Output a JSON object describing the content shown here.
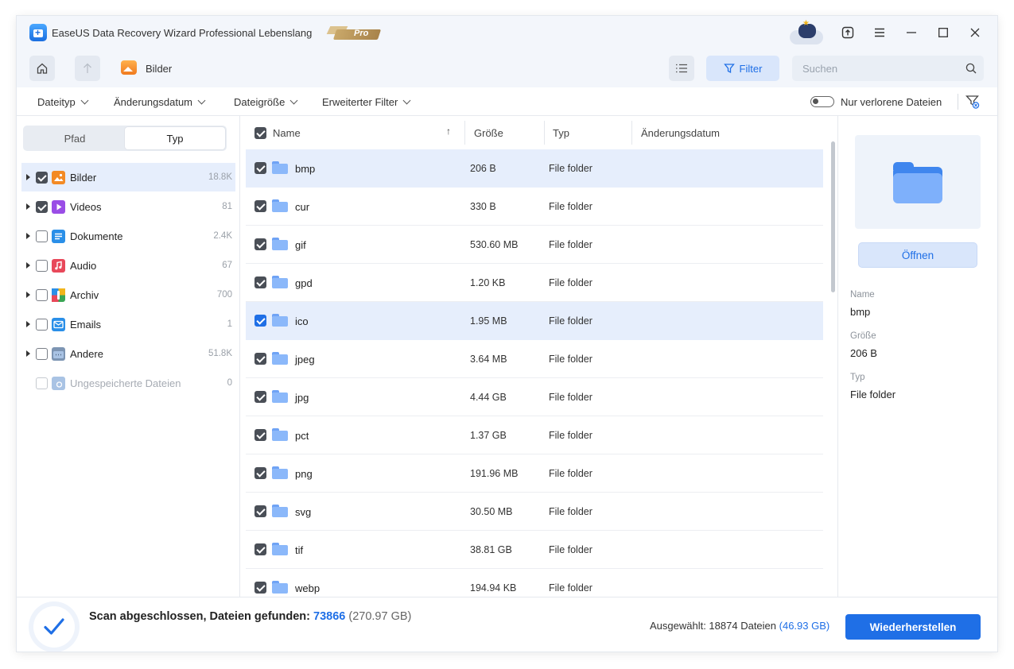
{
  "window": {
    "title": "EaseUS Data Recovery Wizard Professional Lebenslang",
    "badge": "Pro"
  },
  "nav": {
    "breadcrumb": "Bilder",
    "filter_label": "Filter",
    "search_placeholder": "Suchen"
  },
  "filters": {
    "dropdowns": [
      "Dateityp",
      "Änderungsdatum",
      "Dateigröße",
      "Erweiterter Filter"
    ],
    "toggle_label": "Nur verlorene Dateien",
    "toggle_on": false
  },
  "sidebar": {
    "tabs": [
      "Pfad",
      "Typ"
    ],
    "active_tab": "Typ",
    "items": [
      {
        "label": "Bilder",
        "count": "18.8K",
        "checked": true,
        "expandable": true,
        "selected": true,
        "icon": "image-icon",
        "color": "#f38a24"
      },
      {
        "label": "Videos",
        "count": "81",
        "checked": true,
        "expandable": true,
        "selected": false,
        "icon": "video-icon",
        "color": "#9a4de6"
      },
      {
        "label": "Dokumente",
        "count": "2.4K",
        "checked": false,
        "expandable": true,
        "selected": false,
        "icon": "document-icon",
        "color": "#2a8fe8"
      },
      {
        "label": "Audio",
        "count": "67",
        "checked": false,
        "expandable": true,
        "selected": false,
        "icon": "audio-icon",
        "color": "#e8485a"
      },
      {
        "label": "Archiv",
        "count": "700",
        "checked": false,
        "expandable": true,
        "selected": false,
        "icon": "archive-icon",
        "color": "#3aa655"
      },
      {
        "label": "Emails",
        "count": "1",
        "checked": false,
        "expandable": true,
        "selected": false,
        "icon": "email-icon",
        "color": "#2a8fe8"
      },
      {
        "label": "Andere",
        "count": "51.8K",
        "checked": false,
        "expandable": true,
        "selected": false,
        "icon": "other-files-icon",
        "color": "#7d95b3"
      },
      {
        "label": "Ungespeicherte Dateien",
        "count": "0",
        "checked": false,
        "expandable": false,
        "selected": false,
        "disabled": true,
        "icon": "unsaved-files-icon",
        "color": "#a9c3e4"
      }
    ]
  },
  "list": {
    "columns": [
      "Name",
      "Größe",
      "Typ",
      "Änderungsdatum"
    ],
    "rows": [
      {
        "name": "bmp",
        "size": "206 B",
        "type": "File folder",
        "checked": true,
        "selected": true
      },
      {
        "name": "cur",
        "size": "330 B",
        "type": "File folder",
        "checked": true,
        "selected": false
      },
      {
        "name": "gif",
        "size": "530.60 MB",
        "type": "File folder",
        "checked": true,
        "selected": false
      },
      {
        "name": "gpd",
        "size": "1.20 KB",
        "type": "File folder",
        "checked": true,
        "selected": false
      },
      {
        "name": "ico",
        "size": "1.95 MB",
        "type": "File folder",
        "checked": true,
        "selected": true,
        "focus": true
      },
      {
        "name": "jpeg",
        "size": "3.64 MB",
        "type": "File folder",
        "checked": true,
        "selected": false
      },
      {
        "name": "jpg",
        "size": "4.44 GB",
        "type": "File folder",
        "checked": true,
        "selected": false
      },
      {
        "name": "pct",
        "size": "1.37 GB",
        "type": "File folder",
        "checked": true,
        "selected": false
      },
      {
        "name": "png",
        "size": "191.96 MB",
        "type": "File folder",
        "checked": true,
        "selected": false
      },
      {
        "name": "svg",
        "size": "30.50 MB",
        "type": "File folder",
        "checked": true,
        "selected": false
      },
      {
        "name": "tif",
        "size": "38.81 GB",
        "type": "File folder",
        "checked": true,
        "selected": false
      },
      {
        "name": "webp",
        "size": "194.94 KB",
        "type": "File folder",
        "checked": true,
        "selected": false
      }
    ]
  },
  "preview": {
    "open_label": "Öffnen",
    "name_label": "Name",
    "name_value": "bmp",
    "size_label": "Größe",
    "size_value": "206 B",
    "type_label": "Typ",
    "type_value": "File folder"
  },
  "status": {
    "scan_text": "Scan abgeschlossen, Dateien gefunden: ",
    "found_count": "73866",
    "found_size": "(270.97 GB)",
    "selected_text": "Ausgewählt: 18874 Dateien",
    "selected_size": "(46.93 GB)",
    "recover_label": "Wiederherstellen"
  },
  "colors": {
    "accent": "#1f6fe6",
    "selection": "#e6eefc"
  }
}
